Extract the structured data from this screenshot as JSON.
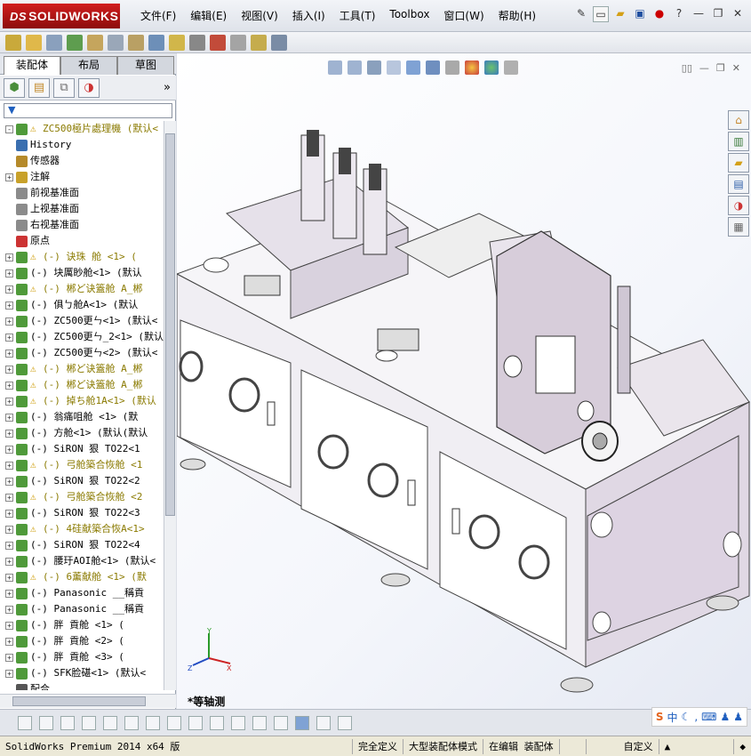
{
  "app": {
    "logo_ds": "DS",
    "logo_text": "SOLIDWORKS"
  },
  "menu": [
    "文件(F)",
    "编辑(E)",
    "视图(V)",
    "插入(I)",
    "工具(T)",
    "Toolbox",
    "窗口(W)",
    "帮助(H)"
  ],
  "tabs": [
    {
      "label": "装配体"
    },
    {
      "label": "布局"
    },
    {
      "label": "草图"
    }
  ],
  "tree": [
    {
      "label": "ZC500極片處理機  (默认<",
      "warn": true,
      "yellow": true,
      "expander": "-",
      "icon": "assembly"
    },
    {
      "label": "History",
      "warn": false,
      "yellow": false,
      "expander": "",
      "icon": "history"
    },
    {
      "label": "传感器",
      "warn": false,
      "yellow": false,
      "expander": "",
      "icon": "sensor"
    },
    {
      "label": "注解",
      "warn": false,
      "yellow": false,
      "expander": "+",
      "icon": "annotation"
    },
    {
      "label": "前视基准面",
      "warn": false,
      "yellow": false,
      "expander": "",
      "icon": "plane"
    },
    {
      "label": "上视基准面",
      "warn": false,
      "yellow": false,
      "expander": "",
      "icon": "plane"
    },
    {
      "label": "右视基准面",
      "warn": false,
      "yellow": false,
      "expander": "",
      "icon": "plane"
    },
    {
      "label": "原点",
      "warn": false,
      "yellow": false,
      "expander": "",
      "icon": "origin"
    },
    {
      "label": "(-) 诀珠  舱  <1> (",
      "warn": true,
      "yellow": true,
      "expander": "+",
      "icon": "part"
    },
    {
      "label": "(-)   块厲眇舱<1> (默认",
      "warn": false,
      "yellow": false,
      "expander": "+",
      "icon": "part"
    },
    {
      "label": "(-) 郴ど诀篕舱  A_郴",
      "warn": true,
      "yellow": true,
      "expander": "+",
      "icon": "part"
    },
    {
      "label": "(-) 俱ㄅ舱A<1> (默认",
      "warn": false,
      "yellow": false,
      "expander": "+",
      "icon": "part"
    },
    {
      "label": "(-) ZC500更ㄣ<1> (默认<",
      "warn": false,
      "yellow": false,
      "expander": "+",
      "icon": "part"
    },
    {
      "label": "(-) ZC500更ㄣ_2<1> (默认",
      "warn": false,
      "yellow": false,
      "expander": "+",
      "icon": "part"
    },
    {
      "label": "(-) ZC500更ㄣ<2> (默认<",
      "warn": false,
      "yellow": false,
      "expander": "+",
      "icon": "part"
    },
    {
      "label": "(-) 郴ど诀篕舱  A_郴",
      "warn": true,
      "yellow": true,
      "expander": "+",
      "icon": "part"
    },
    {
      "label": "(-) 郴ど诀篕舱  A_郴",
      "warn": true,
      "yellow": true,
      "expander": "+",
      "icon": "part"
    },
    {
      "label": "(-) 掉ち舱1A<1> (默认",
      "warn": true,
      "yellow": true,
      "expander": "+",
      "icon": "part"
    },
    {
      "label": "(-)   翁痛咀舱  <1> (默",
      "warn": false,
      "yellow": false,
      "expander": "+",
      "icon": "part"
    },
    {
      "label": "(-)   方舱<1> (默认(默认",
      "warn": false,
      "yellow": false,
      "expander": "+",
      "icon": "part"
    },
    {
      "label": "(-) SiRON 狠    TO22<1",
      "warn": false,
      "yellow": false,
      "expander": "+",
      "icon": "part"
    },
    {
      "label": "(-) 弓舱築合恢舱  <1",
      "warn": true,
      "yellow": true,
      "expander": "+",
      "icon": "part"
    },
    {
      "label": "(-) SiRON 狠    TO22<2",
      "warn": false,
      "yellow": false,
      "expander": "+",
      "icon": "part"
    },
    {
      "label": "(-) 弓舱築合恢舱  <2",
      "warn": true,
      "yellow": true,
      "expander": "+",
      "icon": "part"
    },
    {
      "label": "(-) SiRON 狠    TO22<3",
      "warn": false,
      "yellow": false,
      "expander": "+",
      "icon": "part"
    },
    {
      "label": "(-) 4硅献築合恢A<1>",
      "warn": true,
      "yellow": true,
      "expander": "+",
      "icon": "part"
    },
    {
      "label": "(-) SiRON 狠    TO22<4",
      "warn": false,
      "yellow": false,
      "expander": "+",
      "icon": "part"
    },
    {
      "label": "(-) 腰玗AOI舱<1> (默认<",
      "warn": false,
      "yellow": false,
      "expander": "+",
      "icon": "part"
    },
    {
      "label": "(-) 6薰献舱  <1> (默",
      "warn": true,
      "yellow": true,
      "expander": "+",
      "icon": "part"
    },
    {
      "label": "(-) Panasonic   __稱貢",
      "warn": false,
      "yellow": false,
      "expander": "+",
      "icon": "part"
    },
    {
      "label": "(-) Panasonic   __稱貢",
      "warn": false,
      "yellow": false,
      "expander": "+",
      "icon": "part"
    },
    {
      "label": "(-)   胖    貢舱  <1> (",
      "warn": false,
      "yellow": false,
      "expander": "+",
      "icon": "part"
    },
    {
      "label": "(-)   胖    貢舱  <2> (",
      "warn": false,
      "yellow": false,
      "expander": "+",
      "icon": "part"
    },
    {
      "label": "(-)   胖    貢舱  <3> (",
      "warn": false,
      "yellow": false,
      "expander": "+",
      "icon": "part"
    },
    {
      "label": "(-) SFK脸碪<1> (默认<",
      "warn": false,
      "yellow": false,
      "expander": "+",
      "icon": "part"
    },
    {
      "label": "配合",
      "warn": false,
      "yellow": false,
      "expander": "",
      "icon": "mate"
    }
  ],
  "view": {
    "view_name": "*等轴测"
  },
  "status": {
    "product": "SolidWorks Premium 2014 x64 版",
    "definition": "完全定义",
    "mode": "大型装配体模式",
    "editing": "在编辑 装配体",
    "units": "自定义"
  },
  "colors": {
    "accent": "#c8101c",
    "tree_yellow": "#8a7a00",
    "machine": "#e3dde6"
  }
}
